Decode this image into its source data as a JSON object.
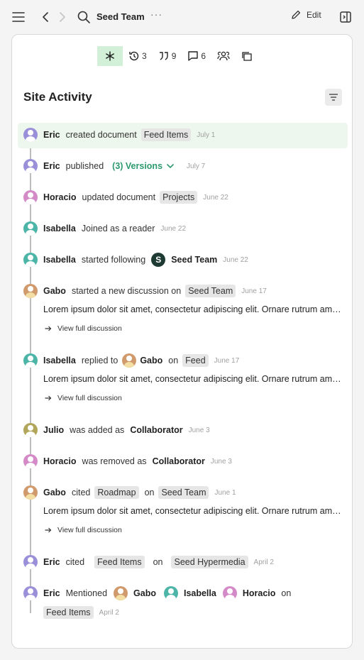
{
  "topbar": {
    "title": "Seed Team",
    "more": "···",
    "edit_label": "Edit"
  },
  "filters": [
    {
      "icon": "asterisk-icon",
      "count": ""
    },
    {
      "icon": "history-icon",
      "count": "3"
    },
    {
      "icon": "quote-icon",
      "count": "9"
    },
    {
      "icon": "comment-icon",
      "count": "6"
    },
    {
      "icon": "people-icon",
      "count": ""
    },
    {
      "icon": "copy-icon",
      "count": ""
    }
  ],
  "section_title": "Site Activity",
  "link_label": "View full discussion",
  "lorem": "Lorem ipsum dolor sit amet, consectetur adipiscing elit. Ornare rutrum amet, a tempor",
  "activity": {
    "a1": {
      "name": "Eric",
      "text": "created document",
      "tag": "Feed Items",
      "date": "July 1"
    },
    "a2": {
      "name": "Eric",
      "text": "published",
      "versions": "(3) Versions",
      "date": "July 7"
    },
    "a3": {
      "name": "Horacio",
      "text": "updated document",
      "tag": "Projects",
      "date": "June 22"
    },
    "a4": {
      "name": "Isabella",
      "text": "Joined as a reader",
      "date": "June 22"
    },
    "a5": {
      "name": "Isabella",
      "text": "started following",
      "logo": "S",
      "target": "Seed Team",
      "date": "June 22"
    },
    "a6": {
      "name": "Gabo",
      "text": "started a new discussion on",
      "tag": "Seed Team",
      "date": "June 17"
    },
    "a7": {
      "name": "Isabella",
      "text": "replied to",
      "target": "Gabo",
      "on": "on",
      "tag": "Feed",
      "date": "June 17"
    },
    "a8": {
      "name": "Julio",
      "text": "was added as",
      "role": "Collaborator",
      "date": "June 3"
    },
    "a9": {
      "name": "Horacio",
      "text": "was removed as",
      "role": "Collaborator",
      "date": "June 3"
    },
    "a10": {
      "name": "Gabo",
      "text": "cited",
      "tag": "Roadmap",
      "on": "on",
      "tag2": "Seed Team",
      "date": "June 1"
    },
    "a11": {
      "name": "Eric",
      "text": "cited",
      "tag": "Feed Items",
      "on": "on",
      "tag2": "Seed Hypermedia",
      "date": "April 2"
    },
    "a12": {
      "name": "Eric",
      "text": "Mentioned",
      "m1": "Gabo",
      "m2": "Isabella",
      "m3": "Horacio",
      "on": "on",
      "tag": "Feed Items",
      "date": "April 2"
    }
  },
  "colors": {
    "accent_green": "#2c9a6e",
    "highlight": "#eef7ee",
    "active_filter": "#d2f0d7"
  }
}
